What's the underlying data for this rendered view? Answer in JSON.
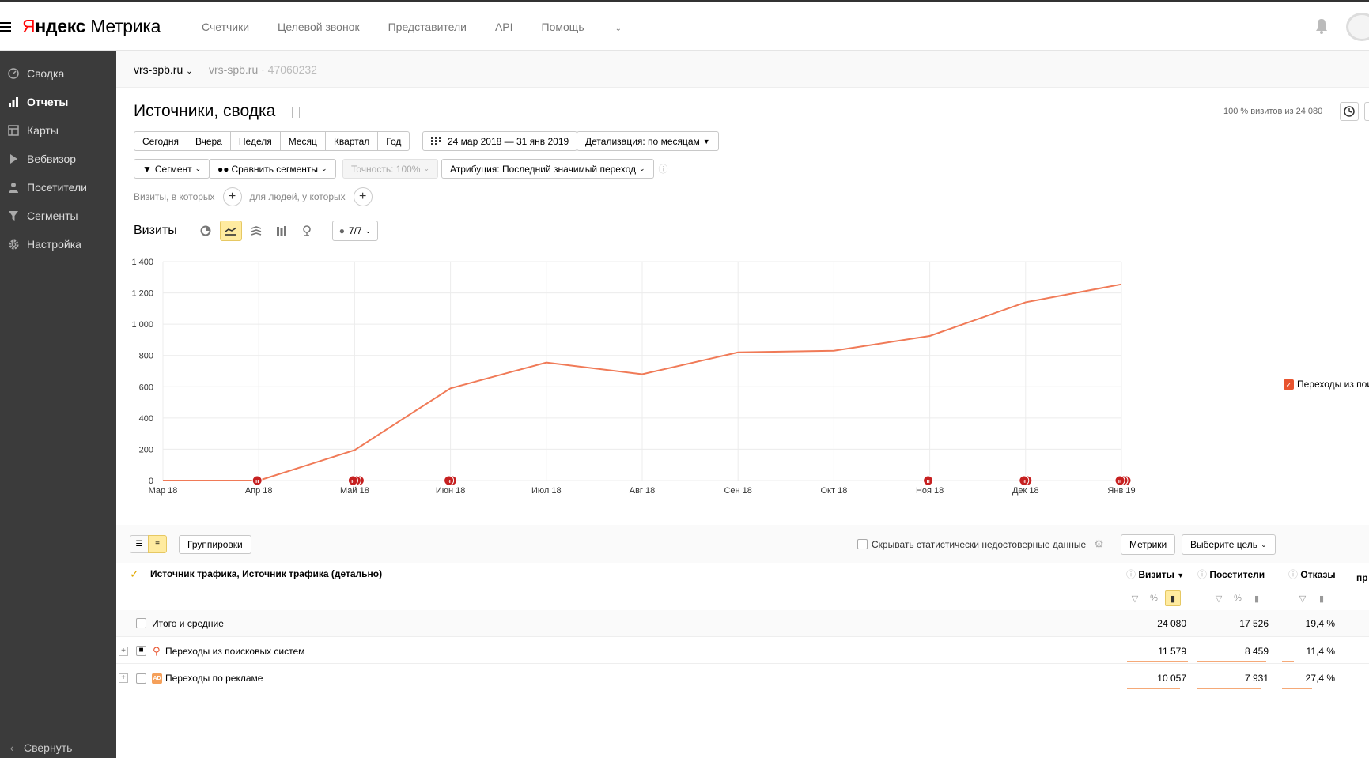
{
  "app": {
    "logo_prefix": "Я",
    "logo_bold": "ндекс",
    "logo_rest": " Метрика"
  },
  "topnav": {
    "items": [
      "Счетчики",
      "Целевой звонок",
      "Представители",
      "API",
      "Помощь"
    ]
  },
  "sidebar": {
    "items": [
      {
        "label": "Сводка",
        "icon": "dashboard-icon"
      },
      {
        "label": "Отчеты",
        "icon": "reports-icon"
      },
      {
        "label": "Карты",
        "icon": "maps-icon"
      },
      {
        "label": "Вебвизор",
        "icon": "play-icon"
      },
      {
        "label": "Посетители",
        "icon": "user-icon"
      },
      {
        "label": "Сегменты",
        "icon": "filter-icon"
      },
      {
        "label": "Настройка",
        "icon": "gear-icon"
      }
    ],
    "collapse_label": "Свернуть"
  },
  "counter": {
    "site": "vrs-spb.ru",
    "site_secondary": "vrs-spb.ru",
    "id": "· 47060232"
  },
  "report": {
    "title": "Источники, сводка",
    "summary": "100 % визитов из 24 080"
  },
  "periods": [
    "Сегодня",
    "Вчера",
    "Неделя",
    "Месяц",
    "Квартал",
    "Год"
  ],
  "date_range": "24 мар 2018 — 31 янв 2019",
  "detail": "Детализация: по месяцам",
  "toolbar": {
    "segment": "Сегмент",
    "compare": "Сравнить сегменты",
    "accuracy": "Точность: 100%",
    "attribution": "Атрибуция: Последний значимый переход"
  },
  "filters": {
    "visits_label": "Визиты, в которых",
    "people_label": "для людей, у которых"
  },
  "chart_header": {
    "title": "Визиты",
    "series_count": "7/7"
  },
  "chart_data": {
    "type": "line",
    "x": [
      "Мар 18",
      "Апр 18",
      "Май 18",
      "Июн 18",
      "Июл 18",
      "Авг 18",
      "Сен 18",
      "Окт 18",
      "Ноя 18",
      "Дек 18",
      "Янв 19"
    ],
    "series": [
      {
        "name": "Переходы из поисковых систем",
        "values": [
          0,
          0,
          195,
          590,
          755,
          680,
          820,
          830,
          925,
          1140,
          1255
        ],
        "color": "#f07a57"
      }
    ],
    "yticks": [
      0,
      200,
      400,
      600,
      800,
      1000,
      1200,
      1400
    ],
    "ytick_labels": [
      "0",
      "200",
      "400",
      "600",
      "800",
      "1 000",
      "1 200",
      "1 400"
    ],
    "ylim": [
      0,
      1400
    ],
    "grid": true,
    "annotations": [
      {
        "x": "Апр 18",
        "label": "н",
        "count": 1
      },
      {
        "x": "Май 18",
        "label": "н",
        "count": 3
      },
      {
        "x": "Июн 18",
        "label": "н",
        "count": 2
      },
      {
        "x": "Ноя 18",
        "label": "н",
        "count": 1
      },
      {
        "x": "Дек 18",
        "label": "н",
        "count": 2
      },
      {
        "x": "Янв 19",
        "label": "н",
        "count": 3
      }
    ],
    "legend_placement": "right",
    "legend_label": "Переходы из пои"
  },
  "table": {
    "groupings_label": "Группировки",
    "hide_unreliable": "Скрывать статистически недостоверные данные",
    "metrics_button": "Метрики",
    "goal_button": "Выберите цель",
    "dimension_header": "Источник трафика, Источник трафика (детально)",
    "columns": [
      "Визиты",
      "Посетители",
      "Отказы",
      "пр"
    ],
    "totals_label": "Итого и средние",
    "totals": [
      "24 080",
      "17 526",
      "19,4 %"
    ],
    "rows": [
      {
        "label": "Переходы из поисковых систем",
        "values": [
          "11 579",
          "8 459",
          "11,4 %"
        ],
        "icon": "search-icon"
      },
      {
        "label": "Переходы по рекламе",
        "values": [
          "10 057",
          "7 931",
          "27,4 %"
        ],
        "icon": "ad-icon"
      }
    ],
    "ad_badge": "AD"
  }
}
